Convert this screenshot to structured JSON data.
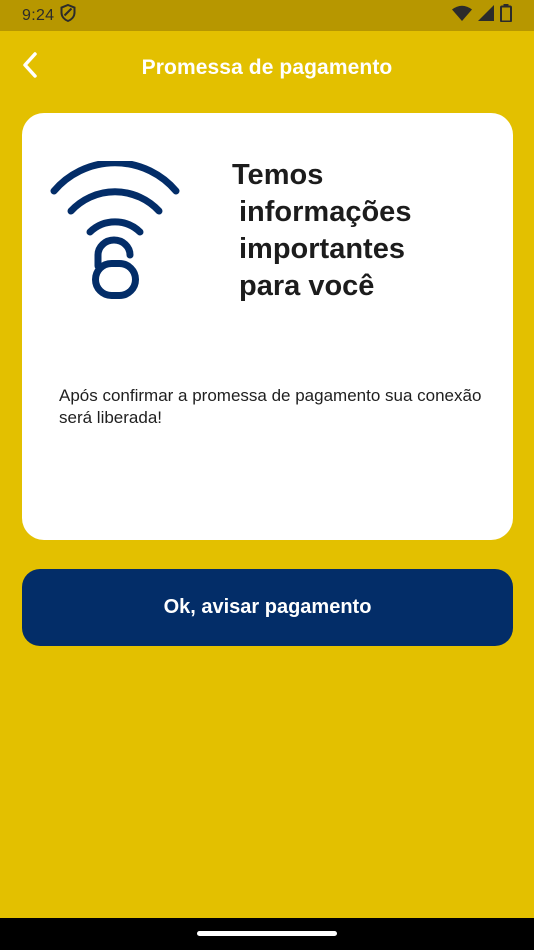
{
  "status_bar": {
    "time": "9:24",
    "icons": [
      "vpn-shield-icon",
      "wifi-icon",
      "signal-icon",
      "battery-icon"
    ]
  },
  "header": {
    "title": "Promessa de pagamento",
    "back_icon": "chevron-left-icon"
  },
  "card": {
    "icon": "wifi-lock-icon",
    "heading_lines": [
      "Temos",
      "informações",
      "importantes",
      "para você"
    ],
    "message": "Após confirmar a promessa de pagamento sua conexão será liberada!"
  },
  "action": {
    "button_label": "Ok, avisar pagamento"
  },
  "colors": {
    "background": "#e3c000",
    "status_bar": "#b79700",
    "primary": "#032d68",
    "card": "#ffffff"
  }
}
